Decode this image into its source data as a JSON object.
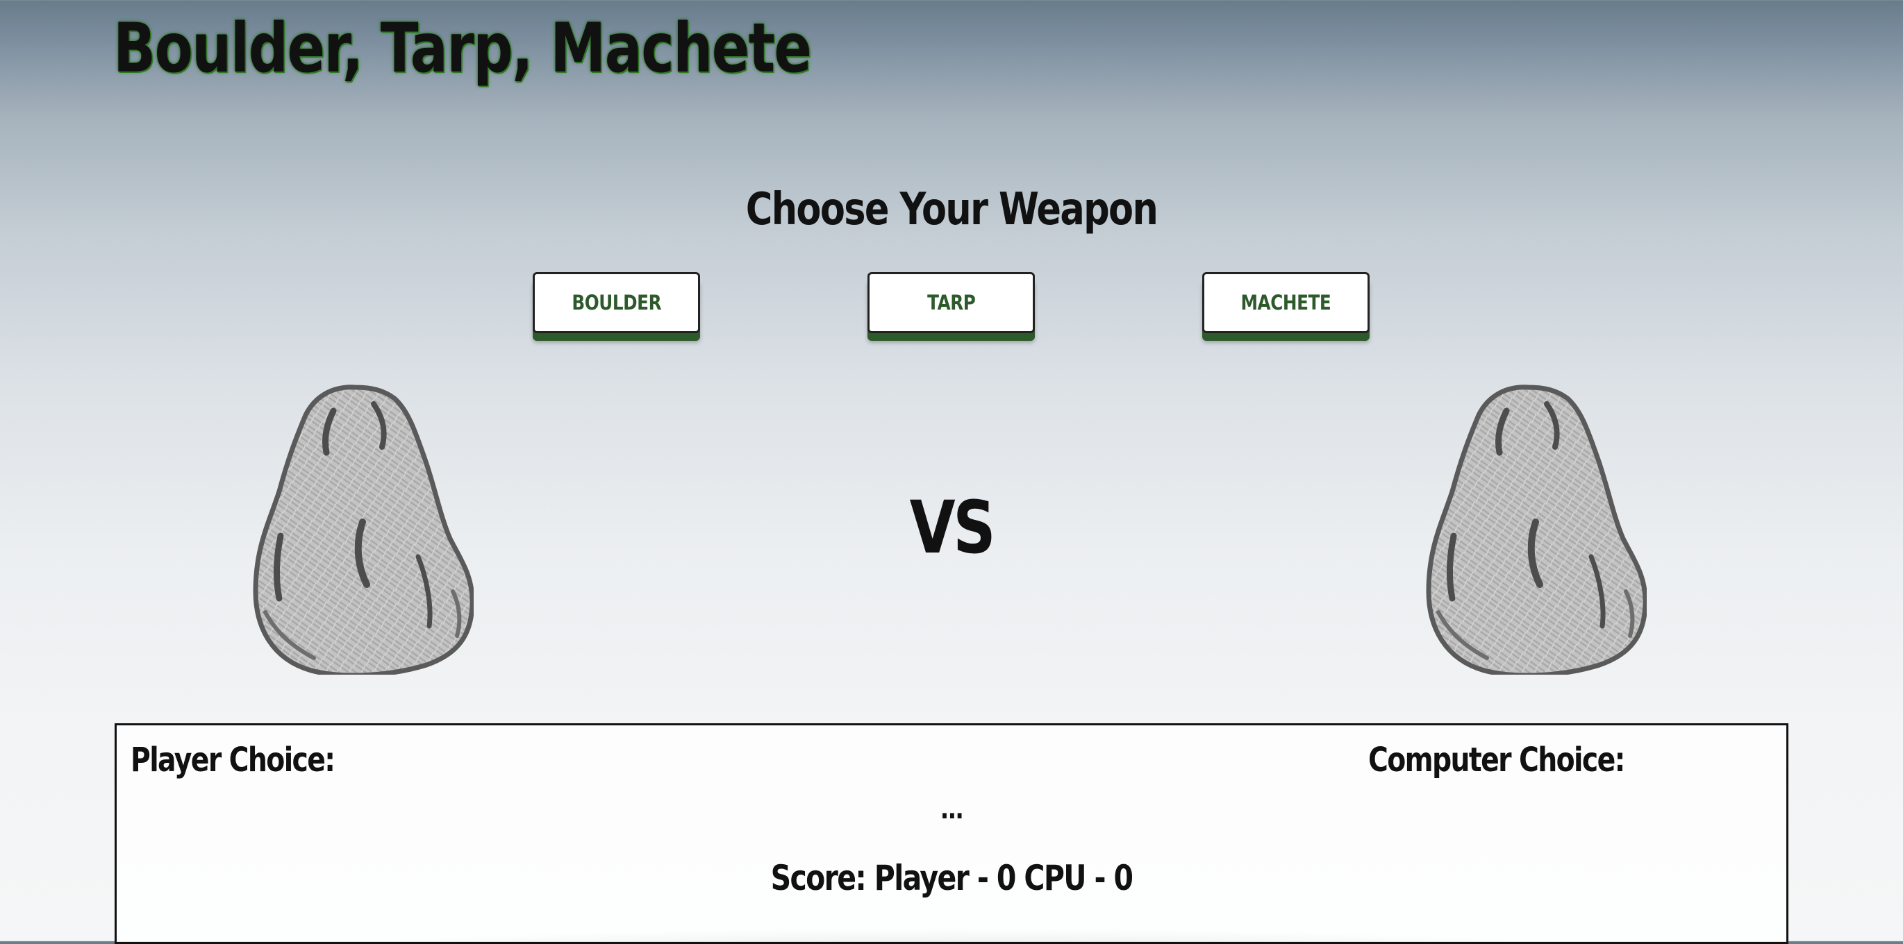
{
  "header": {
    "title": "Boulder, Tarp, Machete"
  },
  "weapon_select": {
    "heading": "Choose Your Weapon",
    "buttons": [
      {
        "label": "BOULDER"
      },
      {
        "label": "TARP"
      },
      {
        "label": "MACHETE"
      }
    ]
  },
  "arena": {
    "player_weapon_icon": "boulder-icon",
    "vs_label": "VS",
    "computer_weapon_icon": "boulder-icon"
  },
  "results": {
    "player_choice_label": "Player Choice:",
    "computer_choice_label": "Computer Choice:",
    "message": "...",
    "score_text": "Score: Player - 0 CPU - 0"
  },
  "colors": {
    "accent_green": "#2d5a2a",
    "title_glow": "#2f7a25",
    "text": "#111111"
  }
}
